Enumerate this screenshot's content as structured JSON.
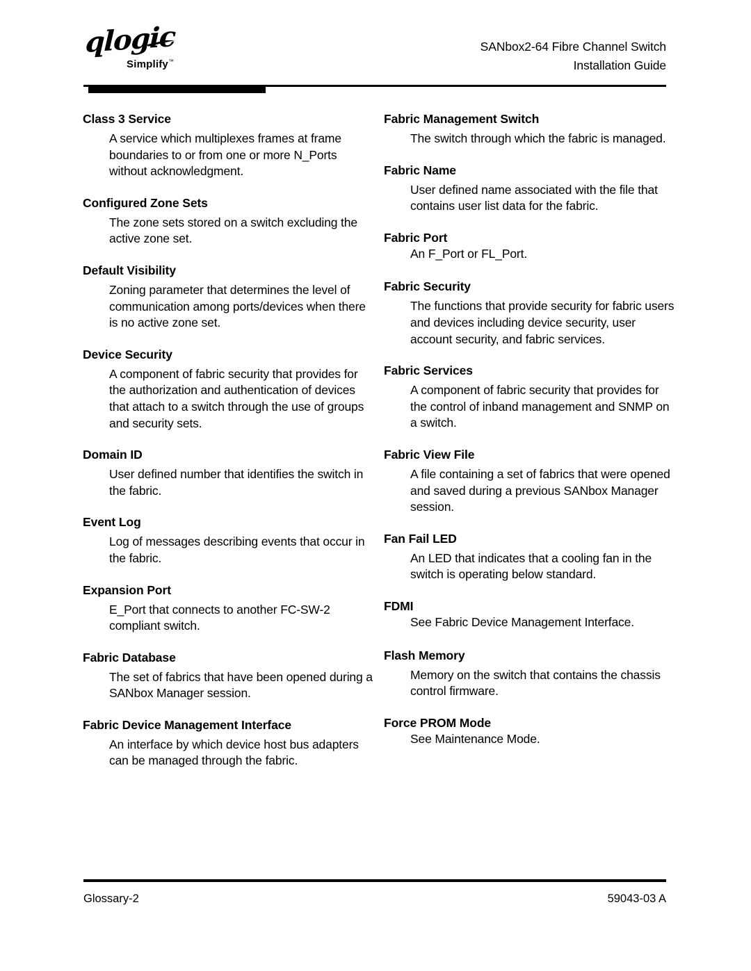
{
  "header": {
    "logo": {
      "wordmark": "qlogic",
      "tagline": "Simplify",
      "trademark": "™"
    },
    "title_line1": "SANbox2-64 Fibre Channel Switch",
    "title_line2": "Installation Guide"
  },
  "columns": {
    "left": [
      {
        "term": "Class 3 Service",
        "definition": "A service which multiplexes frames at frame boundaries to or from one or more N_Ports without acknowledgment.",
        "single_line": false
      },
      {
        "term": "Configured Zone Sets",
        "definition": "The zone sets stored on a switch excluding the active zone set.",
        "single_line": false
      },
      {
        "term": "Default Visibility",
        "definition": "Zoning parameter that determines the level of communication among ports/devices when there is no active zone set.",
        "single_line": false
      },
      {
        "term": "Device Security",
        "definition": "A component of fabric security that provides for the authorization and authentication of devices that attach to a switch through the use of groups and security sets.",
        "single_line": false
      },
      {
        "term": "Domain ID",
        "definition": "User defined number that identifies the switch in the fabric.",
        "single_line": false
      },
      {
        "term": "Event Log",
        "definition": "Log of messages describing events that occur in the fabric.",
        "single_line": false
      },
      {
        "term": "Expansion Port",
        "definition": "E_Port that connects to another FC-SW-2 compliant switch.",
        "single_line": false
      },
      {
        "term": "Fabric Database",
        "definition": "The set of fabrics that have been opened during a SANbox Manager session.",
        "single_line": false
      },
      {
        "term": "Fabric Device Management Interface",
        "definition": "An interface by which device host bus adapters can be managed through the fabric.",
        "single_line": false
      }
    ],
    "right": [
      {
        "term": "Fabric Management Switch",
        "definition": "The switch through which the fabric is managed.",
        "single_line": false
      },
      {
        "term": "Fabric Name",
        "definition": "User defined name associated with the file that contains user list data for the fabric.",
        "single_line": false
      },
      {
        "term": "Fabric Port",
        "definition": "An F_Port or FL_Port.",
        "single_line": true
      },
      {
        "term": "Fabric Security",
        "definition": "The functions that provide security for fabric users and devices including device security, user account security, and fabric services.",
        "single_line": false
      },
      {
        "term": "Fabric Services",
        "definition": "A component of fabric security that provides for the control of inband management and SNMP on a switch.",
        "single_line": false
      },
      {
        "term": "Fabric View File",
        "definition": "A file containing a set of fabrics that were opened and saved during a previous SANbox Manager session.",
        "single_line": false
      },
      {
        "term": "Fan Fail LED",
        "definition": "An LED that indicates that a cooling fan in the switch is operating below standard.",
        "single_line": false
      },
      {
        "term": "FDMI",
        "definition": "See Fabric Device Management Interface.",
        "single_line": true
      },
      {
        "term": "Flash Memory",
        "definition": "Memory on the switch that contains the chassis control firmware.",
        "single_line": false
      },
      {
        "term": "Force PROM Mode",
        "definition": "See Maintenance Mode.",
        "single_line": true
      }
    ]
  },
  "footer": {
    "page_label": "Glossary-2",
    "document_number": "59043-03  A"
  }
}
